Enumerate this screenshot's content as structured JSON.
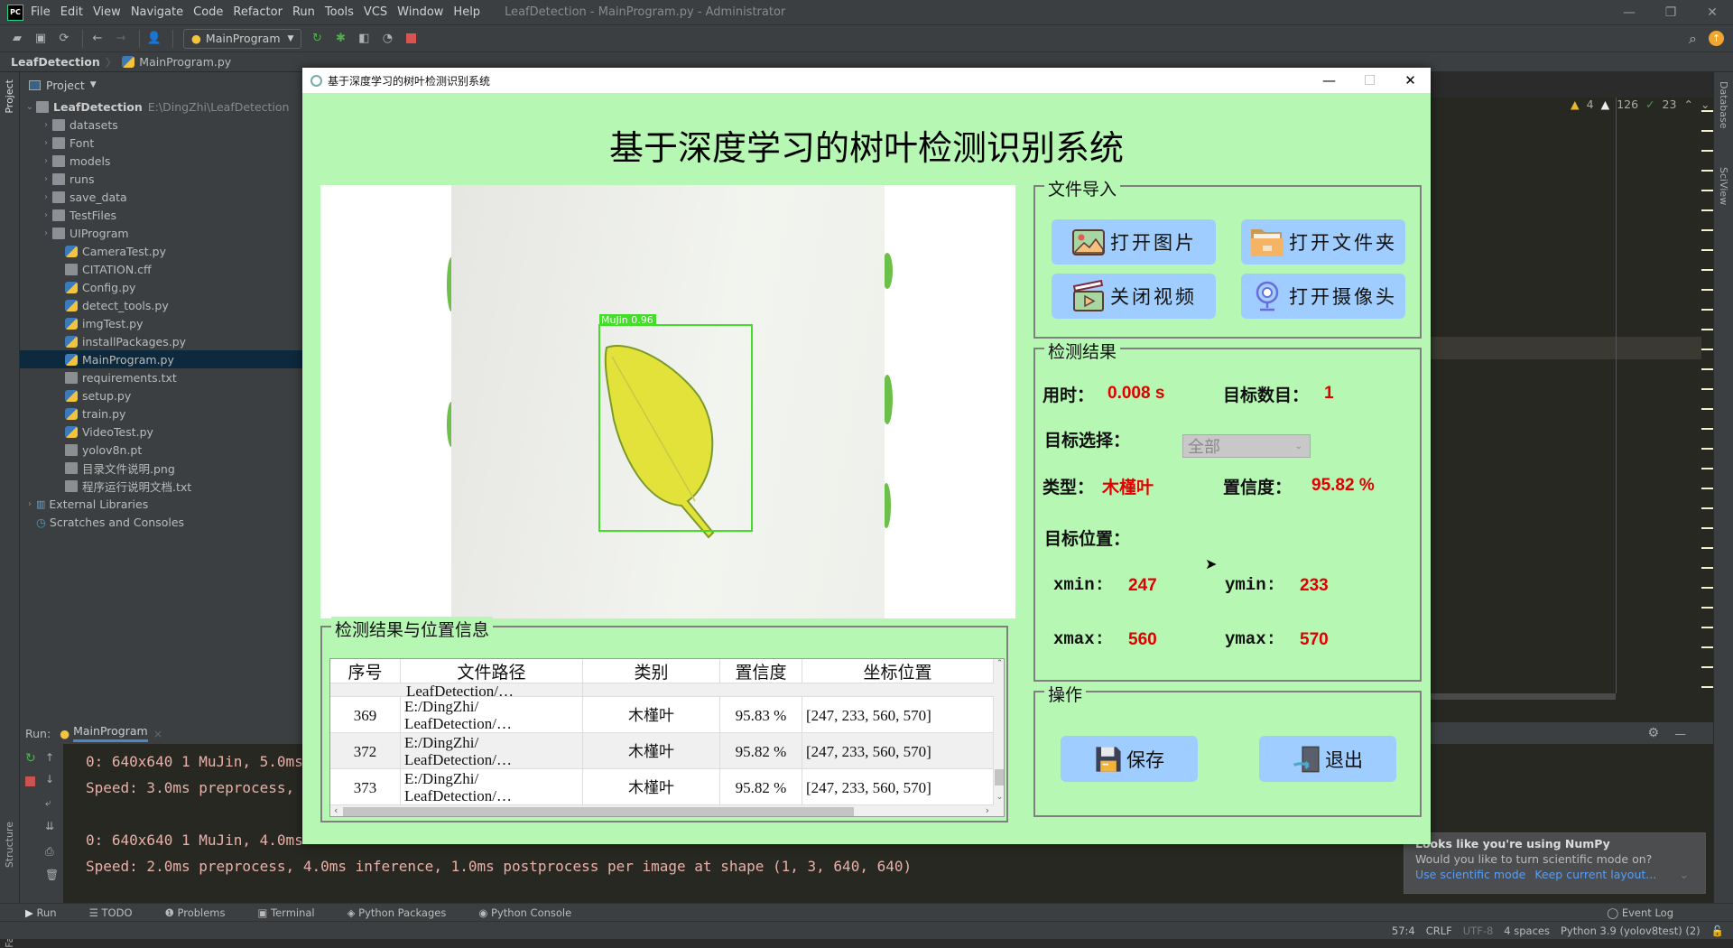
{
  "ide": {
    "logo": "PC",
    "menu": [
      "File",
      "Edit",
      "View",
      "Navigate",
      "Code",
      "Refactor",
      "Run",
      "Tools",
      "VCS",
      "Window",
      "Help"
    ],
    "window_title": "LeafDetection - MainProgram.py - Administrator",
    "run_config": "MainProgram",
    "breadcrumb": {
      "project": "LeafDetection",
      "file": "MainProgram.py"
    },
    "left_tool_tabs": [
      "Project",
      "Structure",
      "Favorites"
    ],
    "right_tool_tabs": [
      "Database",
      "SciView"
    ],
    "inspections": {
      "errors": "4",
      "warnings": "126",
      "ok": "23"
    }
  },
  "project": {
    "header": "Project",
    "root": {
      "name": "LeafDetection",
      "path": "E:\\DingZhi\\LeafDetection"
    },
    "folders": [
      "datasets",
      "Font",
      "models",
      "runs",
      "save_data",
      "TestFiles",
      "UIProgram"
    ],
    "files": [
      {
        "name": "CameraTest.py",
        "type": "py"
      },
      {
        "name": "CITATION.cff",
        "type": "txt"
      },
      {
        "name": "Config.py",
        "type": "py"
      },
      {
        "name": "detect_tools.py",
        "type": "py"
      },
      {
        "name": "imgTest.py",
        "type": "py"
      },
      {
        "name": "installPackages.py",
        "type": "py"
      },
      {
        "name": "MainProgram.py",
        "type": "py",
        "selected": true
      },
      {
        "name": "requirements.txt",
        "type": "txt"
      },
      {
        "name": "setup.py",
        "type": "py"
      },
      {
        "name": "train.py",
        "type": "py"
      },
      {
        "name": "VideoTest.py",
        "type": "py"
      },
      {
        "name": "yolov8n.pt",
        "type": "txt"
      },
      {
        "name": "目录文件说明.png",
        "type": "txt"
      },
      {
        "name": "程序运行说明文档.txt",
        "type": "txt"
      }
    ],
    "external": "External Libraries",
    "scratches": "Scratches and Consoles"
  },
  "run": {
    "label": "Run:",
    "tab": "MainProgram",
    "console": [
      "0: 640x640 1 MuJin, 5.0ms",
      "Speed: 3.0ms preprocess,",
      "",
      "0: 640x640 1 MuJin, 4.0ms",
      "Speed: 2.0ms preprocess, 4.0ms inference, 1.0ms postprocess per image at shape (1, 3, 640, 640)"
    ]
  },
  "bottom_tabs": [
    "Run",
    "TODO",
    "Problems",
    "Terminal",
    "Python Packages",
    "Python Console"
  ],
  "event_log": "Event Log",
  "status": {
    "position": "57:4",
    "line_sep": "CRLF",
    "encoding": "UTF-8",
    "indent": "4 spaces",
    "interpreter": "Python 3.9 (yolov8test) (2)"
  },
  "notification": {
    "title": "Looks like you're using NumPy",
    "message": "Would you like to turn scientific mode on?",
    "action1": "Use scientific mode",
    "action2": "Keep current layout..."
  },
  "app": {
    "window_title": "基于深度学习的树叶检测识别系统",
    "main_title": "基于深度学习的树叶检测识别系统",
    "detection_label": "MuJin  0.96",
    "file_import": {
      "title": "文件导入",
      "open_image": "打开图片",
      "open_folder": "打开文件夹",
      "close_video": "关闭视频",
      "open_camera": "打开摄像头"
    },
    "result": {
      "title": "检测结果",
      "time_label": "用时：",
      "time_value": "0.008 s",
      "count_label": "目标数目：",
      "count_value": "1",
      "select_label": "目标选择：",
      "select_value": "全部",
      "type_label": "类型：",
      "type_value": "木槿叶",
      "conf_label": "置信度：",
      "conf_value": "95.82 %",
      "pos_label": "目标位置：",
      "xmin_label": "xmin:",
      "xmin": "247",
      "ymin_label": "ymin:",
      "ymin": "233",
      "xmax_label": "xmax:",
      "xmax": "560",
      "ymax_label": "ymax:",
      "ymax": "570"
    },
    "ops": {
      "title": "操作",
      "save": "保存",
      "exit": "退出"
    },
    "table": {
      "title": "检测结果与位置信息",
      "headers": [
        "序号",
        "文件路径",
        "类别",
        "置信度",
        "坐标位置"
      ],
      "partial_row": {
        "path": "LeafDetection/…"
      },
      "rows": [
        {
          "id": "369",
          "path1": "E:/DingZhi/",
          "path2": "LeafDetection/…",
          "cls": "木槿叶",
          "conf": "95.83 %",
          "box": "[247, 233, 560, 570]"
        },
        {
          "id": "372",
          "path1": "E:/DingZhi/",
          "path2": "LeafDetection/…",
          "cls": "木槿叶",
          "conf": "95.82 %",
          "box": "[247, 233, 560, 570]"
        },
        {
          "id": "373",
          "path1": "E:/DingZhi/",
          "path2": "LeafDetection/…",
          "cls": "木槿叶",
          "conf": "95.82 %",
          "box": "[247, 233, 560, 570]"
        }
      ]
    }
  }
}
